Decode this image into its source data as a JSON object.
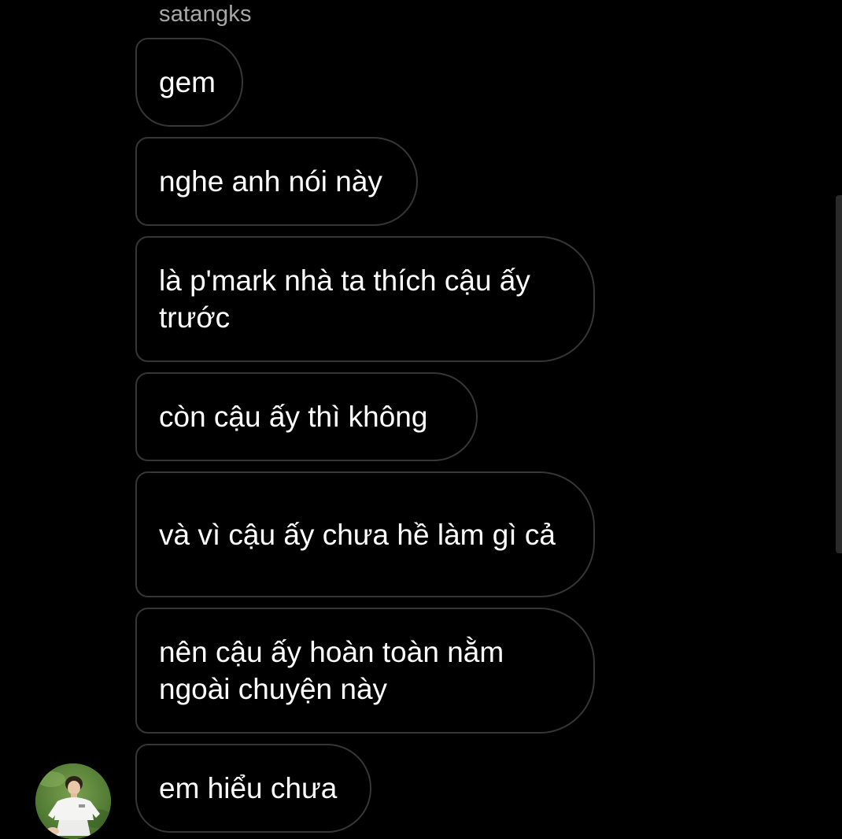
{
  "thread": {
    "sender_name": "satangks",
    "messages": [
      {
        "text": "gem"
      },
      {
        "text": "nghe anh nói này"
      },
      {
        "text": "là p'mark nhà ta thích cậu ấy trước"
      },
      {
        "text": "còn cậu ấy thì không"
      },
      {
        "text": "và vì cậu ấy chưa hề làm gì cả"
      },
      {
        "text": "nên cậu ấy hoàn toàn nằm ngoài chuyện này"
      },
      {
        "text": "em hiểu chưa"
      }
    ]
  },
  "colors": {
    "background": "#000000",
    "bubble_border": "#363636",
    "message_text": "#ffffff",
    "sender_text": "#a8a8a8"
  },
  "icons": {
    "avatar": "profile-photo"
  }
}
